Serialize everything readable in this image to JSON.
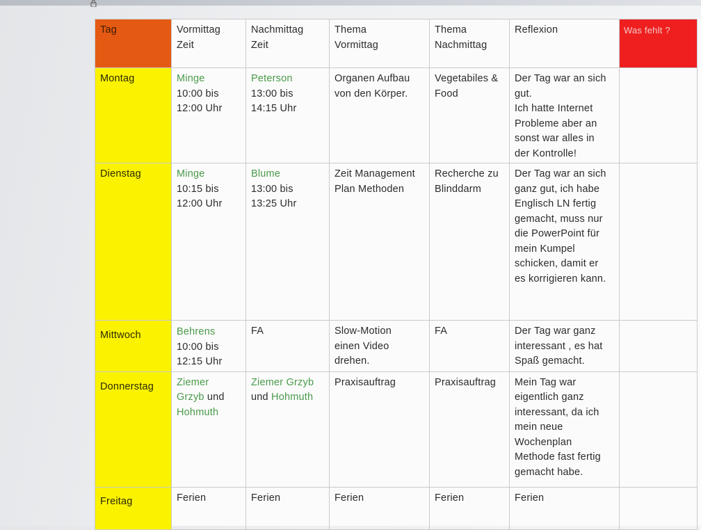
{
  "headers": {
    "tag": "Tag",
    "vormittag_line1": "Vormittag",
    "vormittag_line2": "Zeit",
    "nachmittag_line1": "Nachmittag",
    "nachmittag_line2": "Zeit",
    "thema_vm_line1": "Thema",
    "thema_vm_line2": "Vormittag",
    "thema_nm_line1": "Thema",
    "thema_nm_line2": "Nachmittag",
    "reflexion": "Reflexion",
    "was_fehlt": "Was fehlt ?"
  },
  "rows": [
    {
      "day": "Montag",
      "vm_name": "Minge",
      "vm_time1": "10:00 bis",
      "vm_time2": "12:00 Uhr",
      "nm_name": "Peterson",
      "nm_time1": "13:00 bis",
      "nm_time2": "14:15 Uhr",
      "thema_vm": [
        "Organen Aufbau",
        "von den Körper."
      ],
      "thema_nm": [
        "Vegetabiles &",
        "Food"
      ],
      "reflexion": [
        "Der Tag war an sich",
        "gut.",
        "Ich hatte Internet",
        "Probleme aber an",
        "sonst war alles in",
        "der Kontrolle!"
      ]
    },
    {
      "day": "Dienstag",
      "vm_name": "Minge",
      "vm_time1": "10:15 bis",
      "vm_time2": "12:00 Uhr",
      "nm_name": "Blume",
      "nm_time1": "13:00 bis",
      "nm_time2": "13:25 Uhr",
      "thema_vm": [
        "Zeit Management",
        "Plan Methoden"
      ],
      "thema_nm": [
        "Recherche zu",
        "Blinddarm"
      ],
      "reflexion": [
        "Der Tag war an sich",
        "ganz gut, ich habe",
        "Englisch LN fertig",
        "gemacht, muss nur",
        "die PowerPoint für",
        "mein Kumpel",
        "schicken, damit er",
        "es korrigieren kann."
      ]
    },
    {
      "day": "Mittwoch",
      "vm_name": "Behrens",
      "vm_time1": "10:00 bis",
      "vm_time2": "12:15 Uhr",
      "nm_text": "FA",
      "thema_vm": [
        "Slow-Motion",
        "einen Video",
        "drehen."
      ],
      "thema_nm": [
        "FA"
      ],
      "reflexion": [
        "Der Tag war ganz",
        "interessant , es hat",
        "Spaß gemacht."
      ]
    },
    {
      "day": "Donnerstag",
      "vm_name1": "Ziemer",
      "vm_name2": "Grzyb",
      "vm_und": " und",
      "vm_name3": "Hohmuth",
      "nm_name1": "Ziemer Grzyb",
      "nm_und": "und ",
      "nm_name2": "Hohmuth",
      "thema_vm": [
        "Praxisauftrag"
      ],
      "thema_nm": [
        "Praxisauftrag"
      ],
      "reflexion": [
        "Mein Tag war",
        "eigentlich ganz",
        "interessant, da ich",
        "mein neue",
        "Wochenplan",
        "Methode fast fertig",
        "gemacht habe."
      ]
    },
    {
      "day": "Freitag",
      "vm": "Ferien",
      "nm": "Ferien",
      "thema_vm": "Ferien",
      "thema_nm": "Ferien",
      "reflexion": "Ferien"
    }
  ],
  "colors": {
    "tag_header": "#e55a12",
    "day_column": "#fbf200",
    "was_fehlt_header": "#ef1f1f",
    "teacher_name": "#4a9a4a"
  }
}
